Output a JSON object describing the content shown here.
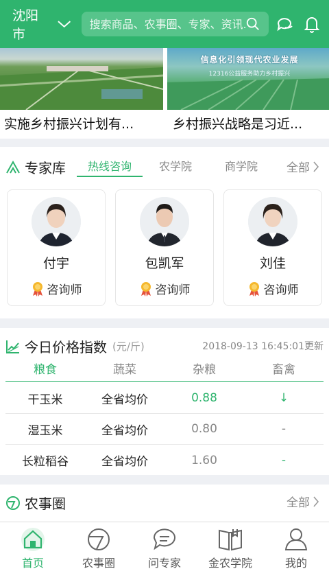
{
  "header": {
    "city": "沈阳市",
    "search_placeholder": "搜索商品、农事圈、专家、资讯...",
    "icons": [
      "chevron-down-icon",
      "search-icon",
      "chat-icon",
      "bell-icon"
    ]
  },
  "banners": [
    {
      "caption": "实施乡村振兴计划有..."
    },
    {
      "caption": "乡村振兴战略是习近...",
      "image_title": "信息化引领现代农业发展",
      "image_subtitle": "12316公益服务助力乡村振兴"
    }
  ],
  "experts": {
    "title": "专家库",
    "tabs": [
      "热线咨询",
      "农学院",
      "商学院"
    ],
    "active_tab": 0,
    "all_label": "全部",
    "cards": [
      {
        "name": "付宇",
        "role": "咨询师"
      },
      {
        "name": "包凯军",
        "role": "咨询师"
      },
      {
        "name": "刘佳",
        "role": "咨询师"
      }
    ]
  },
  "price_index": {
    "title": "今日价格指数",
    "unit": "(元/斤)",
    "updated": "2018-09-13 16:45:01更新",
    "tabs": [
      "粮食",
      "蔬菜",
      "杂粮",
      "畜禽"
    ],
    "active_tab": 0,
    "rows": [
      {
        "name": "干玉米",
        "region": "全省均价",
        "price": "0.88",
        "trend": "↓"
      },
      {
        "name": "湿玉米",
        "region": "全省均价",
        "price": "0.80",
        "trend": "-"
      },
      {
        "name": "长粒稻谷",
        "region": "全省均价",
        "price": "1.60",
        "trend": "-"
      }
    ]
  },
  "farm_circle": {
    "title": "农事圈",
    "all_label": "全部"
  },
  "bottom_nav": [
    {
      "label": "首页",
      "icon": "home-icon"
    },
    {
      "label": "农事圈",
      "icon": "farm-circle-icon"
    },
    {
      "label": "问专家",
      "icon": "ask-expert-icon"
    },
    {
      "label": "金农学院",
      "icon": "book-icon"
    },
    {
      "label": "我的",
      "icon": "user-icon"
    }
  ],
  "colors": {
    "accent": "#2fb46e",
    "background": "#eef0f4"
  }
}
